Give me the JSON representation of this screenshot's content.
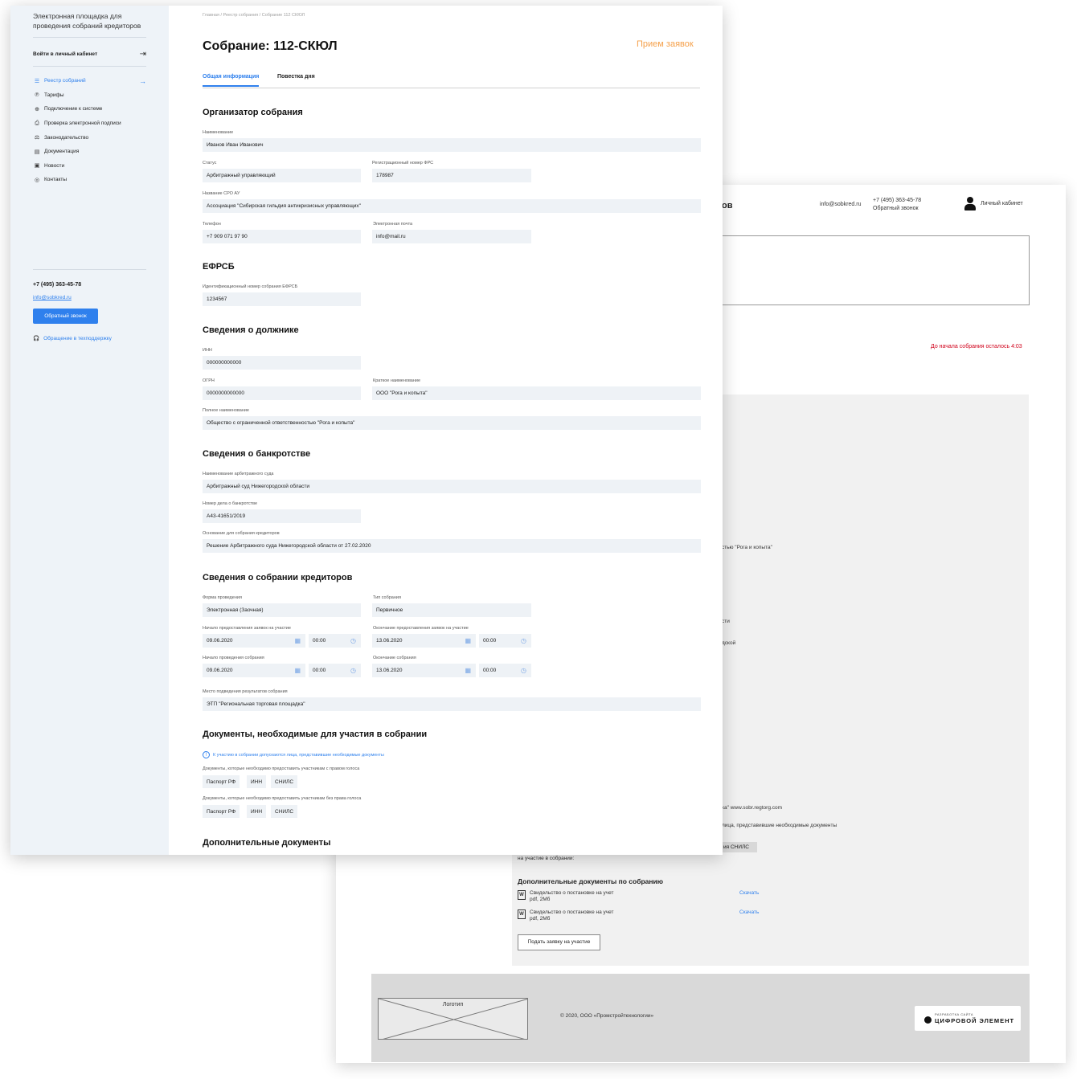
{
  "back": {
    "brand_fragment": "ов",
    "email": "info@sobkred.ru",
    "phone": "+7 (495) 363-45-78",
    "callback": "Обратный звонок",
    "cabinet": "Личный кабинет",
    "timer": "До начала собрания осталось 4:03",
    "fragments": {
      "debtor": "стью \"Рога и копыта\"",
      "court": "сти",
      "basis": "дской",
      "place": "ка\" www.sobr.regtorg.com",
      "admitted": "лица, представившие необходимые документы",
      "chip": "ия СНИЛС",
      "participation": "на участие в собрании:"
    },
    "docs_title": "Дополнительные документы по собранию",
    "docs": [
      {
        "name": "Свидельство о постановке на учет",
        "meta": "pdf, 2Мб",
        "link": "Скачать"
      },
      {
        "name": "Свидельство о постановке на учет",
        "meta": "pdf, 2Мб",
        "link": "Скачать"
      }
    ],
    "apply_button": "Подать заявку на участие",
    "footer": {
      "logo": "Логотип",
      "copyright": "© 2020, ООО «Промстройтехнологии»",
      "dev_small": "РАЗРАБОТКА САЙТА",
      "dev_big": "ЦИФРОВОЙ ЭЛЕМЕНТ"
    }
  },
  "sidebar": {
    "brand": "Электронная площадка для проведения собраний кредиторов",
    "login": "Войти в личный кабинет",
    "nav": [
      {
        "label": "Реестр собраний",
        "icon": "list-icon",
        "glyph": "☰",
        "active": true
      },
      {
        "label": "Тарифы",
        "icon": "tariff-icon",
        "glyph": "℗",
        "active": false
      },
      {
        "label": "Подключение к системе",
        "icon": "plus-circle-icon",
        "glyph": "⊕",
        "active": false
      },
      {
        "label": "Проверка электронной подписи",
        "icon": "signature-icon",
        "glyph": "⎙",
        "active": false
      },
      {
        "label": "Законодательство",
        "icon": "scales-icon",
        "glyph": "⚖",
        "active": false
      },
      {
        "label": "Документация",
        "icon": "document-icon",
        "glyph": "▤",
        "active": false
      },
      {
        "label": "Новости",
        "icon": "news-icon",
        "glyph": "▣",
        "active": false
      },
      {
        "label": "Контакты",
        "icon": "contacts-icon",
        "glyph": "◎",
        "active": false
      }
    ],
    "phone": "+7 (495) 363-45-78",
    "email": "info@sobkred.ru",
    "callback_button": "Обратный звонок",
    "support": "Обращение в техподдержку"
  },
  "main": {
    "breadcrumb": "Главная  /  Реестр собрания  /  Собрание 112 СКЮЛ",
    "title": "Собрание: 112-СКЮЛ",
    "status": "Прием заявок",
    "tabs": [
      "Общая информация",
      "Повестка дня"
    ],
    "organizer": {
      "title": "Организатор собрания",
      "name_label": "Наименование",
      "name": "Иванов Иван Иванович",
      "status_label": "Статус",
      "status": "Арбитражный управляющий",
      "reg_label": "Регистрационный номер ФРС",
      "reg": "178987",
      "sro_label": "Название СРО АУ",
      "sro": "Ассоциация \"Сибирская гильдия антикризисных управляющих\"",
      "phone_label": "Телефон",
      "phone": "+7 909 071 97 90",
      "email_label": "Электронная почта",
      "email": "info@mail.ru"
    },
    "efrsb": {
      "title": "ЕФРСБ",
      "id_label": "Идентификационный номер собрания ЕФРСБ",
      "id": "1234567"
    },
    "debtor": {
      "title": "Сведения о должнике",
      "inn_label": "ИНН",
      "inn": "000000000000",
      "ogrn_label": "ОГРН",
      "ogrn": "0000000000000",
      "short_label": "Краткое наименование",
      "short": "ООО \"Рога и копыта\"",
      "full_label": "Полное наименование",
      "full": "Общество с ограниченной ответственностью \"Рога и копыта\""
    },
    "bankruptcy": {
      "title": "Сведения о банкротстве",
      "court_label": "Наименование арбитражного суда",
      "court": "Арбитражный суд Нижегородской области",
      "case_label": "Номер дела о банкротстве",
      "case": "А43-41651/2019",
      "basis_label": "Основание для собрания кредиторов",
      "basis": "Решение Арбитражного суда Нижегородской области от 27.02.2020"
    },
    "meeting": {
      "title": "Сведения о собрании кредиторов",
      "form_label": "Форма проведения",
      "form": "Электронная (Заочная)",
      "type_label": "Тип собрания",
      "type": "Первичное",
      "app_start_label": "Начало предоставления заявок на участие",
      "app_start_date": "09.06.2020",
      "app_start_time": "00:00",
      "app_end_label": "Окончание предоставления заявок на участие",
      "app_end_date": "13.06.2020",
      "app_end_time": "00:00",
      "start_label": "Начало проведения собрания",
      "start_date": "09.06.2020",
      "start_time": "00:00",
      "end_label": "Окончание собрания",
      "end_date": "13.06.2020",
      "end_time": "00:00",
      "place_label": "Место подведения результатов собрания",
      "place": "ЭТП \"Региональная торговая площадка\""
    },
    "documents": {
      "title": "Документы, необходимые для участия в собрании",
      "info": "К участию в собрании допускаются лица, представившие необходимые документы",
      "voting_label": "Документы, которые необходимо предоставить участникам с правом голоса",
      "voting": [
        "Паспорт РФ",
        "ИНН",
        "СНИЛС"
      ],
      "nonvoting_label": "Документы, которые необходимо предоставить участникам без права голоса",
      "nonvoting": [
        "Паспорт РФ",
        "ИНН",
        "СНИЛС"
      ]
    },
    "extra_title": "Дополнительные документы"
  },
  "colors": {
    "accent": "#2f80ed",
    "status": "#f5a04a",
    "field": "#eef2f6",
    "sidebar": "#eef3f8",
    "timer": "#d0021b"
  }
}
